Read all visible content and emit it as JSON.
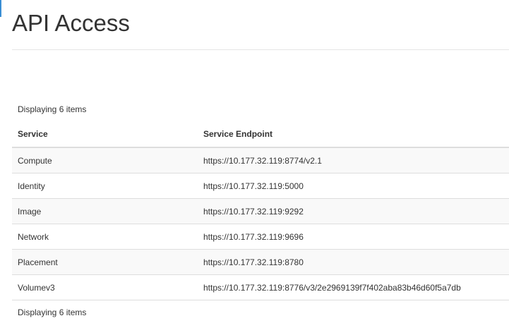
{
  "page": {
    "title": "API Access"
  },
  "table": {
    "count_top": "Displaying 6 items",
    "count_bottom": "Displaying 6 items",
    "columns": [
      "Service",
      "Service Endpoint"
    ],
    "rows": [
      {
        "service": "Compute",
        "endpoint": "https://10.177.32.119:8774/v2.1"
      },
      {
        "service": "Identity",
        "endpoint": "https://10.177.32.119:5000"
      },
      {
        "service": "Image",
        "endpoint": "https://10.177.32.119:9292"
      },
      {
        "service": "Network",
        "endpoint": "https://10.177.32.119:9696"
      },
      {
        "service": "Placement",
        "endpoint": "https://10.177.32.119:8780"
      },
      {
        "service": "Volumev3",
        "endpoint": "https://10.177.32.119:8776/v3/2e2969139f7f402aba83b46d60f5a7db"
      }
    ]
  }
}
